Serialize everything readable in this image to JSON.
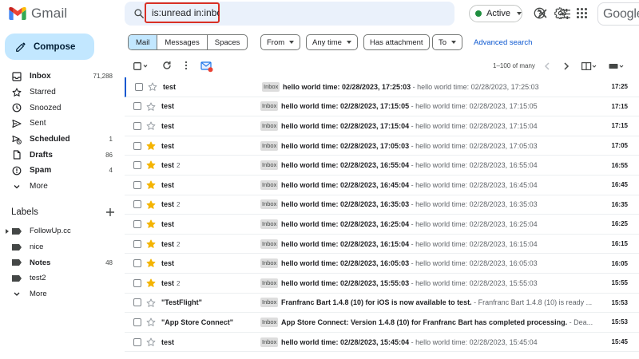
{
  "header": {
    "logo_text": "Gmail",
    "search_query": "is:unread in:inbox",
    "status_label": "Active",
    "status_color": "#1e8e3e",
    "account_brand_text": "Google"
  },
  "sidebar": {
    "compose_label": "Compose",
    "nav_items": [
      {
        "label": "Inbox",
        "count": "71,288",
        "icon": "inbox-icon",
        "bold": true
      },
      {
        "label": "Starred",
        "count": "",
        "icon": "star-icon",
        "bold": false
      },
      {
        "label": "Snoozed",
        "count": "",
        "icon": "clock-icon",
        "bold": false
      },
      {
        "label": "Sent",
        "count": "",
        "icon": "send-icon",
        "bold": false
      },
      {
        "label": "Scheduled",
        "count": "1",
        "icon": "scheduled-icon",
        "bold": true
      },
      {
        "label": "Drafts",
        "count": "86",
        "icon": "draft-icon",
        "bold": true
      },
      {
        "label": "Spam",
        "count": "4",
        "icon": "spam-icon",
        "bold": true
      },
      {
        "label": "More",
        "count": "",
        "icon": "chevron-down-icon",
        "bold": false
      }
    ],
    "labels_heading": "Labels",
    "labels": [
      {
        "label": "FollowUp.cc",
        "count": "",
        "expander": true,
        "bold": false
      },
      {
        "label": "nice",
        "count": "",
        "expander": false,
        "bold": false
      },
      {
        "label": "Notes",
        "count": "48",
        "expander": false,
        "bold": true
      },
      {
        "label": "test2",
        "count": "",
        "expander": false,
        "bold": false
      },
      {
        "label": "More",
        "count": "",
        "expander": false,
        "bold": false
      }
    ]
  },
  "filters": {
    "segments": [
      "Mail",
      "Messages",
      "Spaces"
    ],
    "active_segment": "Mail",
    "chips": [
      "From",
      "Any time",
      "Has attachment",
      "To"
    ],
    "advanced_search": "Advanced search"
  },
  "toolbar": {
    "range_text": "1–100 of many"
  },
  "emails": [
    {
      "sender": "test",
      "count": "",
      "starred": false,
      "badge": "Inbox",
      "subject": "hello world time: 02/28/2023, 17:25:03",
      "snippet": " - hello world time: 02/28/2023, 17:25:03",
      "time": "17:25"
    },
    {
      "sender": "test",
      "count": "",
      "starred": false,
      "badge": "Inbox",
      "subject": "hello world time: 02/28/2023, 17:15:05",
      "snippet": " - hello world time: 02/28/2023, 17:15:05",
      "time": "17:15"
    },
    {
      "sender": "test",
      "count": "",
      "starred": false,
      "badge": "Inbox",
      "subject": "hello world time: 02/28/2023, 17:15:04",
      "snippet": " - hello world time: 02/28/2023, 17:15:04",
      "time": "17:15"
    },
    {
      "sender": "test",
      "count": "",
      "starred": true,
      "badge": "Inbox",
      "subject": "hello world time: 02/28/2023, 17:05:03",
      "snippet": " - hello world time: 02/28/2023, 17:05:03",
      "time": "17:05"
    },
    {
      "sender": "test",
      "count": "2",
      "starred": true,
      "badge": "Inbox",
      "subject": "hello world time: 02/28/2023, 16:55:04",
      "snippet": " - hello world time: 02/28/2023, 16:55:04",
      "time": "16:55"
    },
    {
      "sender": "test",
      "count": "",
      "starred": true,
      "badge": "Inbox",
      "subject": "hello world time: 02/28/2023, 16:45:04",
      "snippet": " - hello world time: 02/28/2023, 16:45:04",
      "time": "16:45"
    },
    {
      "sender": "test",
      "count": "2",
      "starred": true,
      "badge": "Inbox",
      "subject": "hello world time: 02/28/2023, 16:35:03",
      "snippet": " - hello world time: 02/28/2023, 16:35:03",
      "time": "16:35"
    },
    {
      "sender": "test",
      "count": "",
      "starred": true,
      "badge": "Inbox",
      "subject": "hello world time: 02/28/2023, 16:25:04",
      "snippet": " - hello world time: 02/28/2023, 16:25:04",
      "time": "16:25"
    },
    {
      "sender": "test",
      "count": "2",
      "starred": true,
      "badge": "Inbox",
      "subject": "hello world time: 02/28/2023, 16:15:04",
      "snippet": " - hello world time: 02/28/2023, 16:15:04",
      "time": "16:15"
    },
    {
      "sender": "test",
      "count": "",
      "starred": true,
      "badge": "Inbox",
      "subject": "hello world time: 02/28/2023, 16:05:03",
      "snippet": " - hello world time: 02/28/2023, 16:05:03",
      "time": "16:05"
    },
    {
      "sender": "test",
      "count": "2",
      "starred": true,
      "badge": "Inbox",
      "subject": "hello world time: 02/28/2023, 15:55:03",
      "snippet": " - hello world time: 02/28/2023, 15:55:03",
      "time": "15:55"
    },
    {
      "sender": "\"TestFlight\"",
      "count": "",
      "starred": false,
      "badge": "Inbox",
      "subject": "Franfranc Bart 1.4.8 (10) for iOS is now available to test.",
      "snippet": " - Franfranc Bart 1.4.8 (10) is ready ...",
      "time": "15:53"
    },
    {
      "sender": "\"App Store Connect\"",
      "count": "",
      "starred": false,
      "badge": "Inbox",
      "subject": "App Store Connect: Version 1.4.8 (10) for Franfranc Bart has completed processing.",
      "snippet": " - Dea...",
      "time": "15:53"
    },
    {
      "sender": "test",
      "count": "",
      "starred": false,
      "badge": "Inbox",
      "subject": "hello world time: 02/28/2023, 15:45:04",
      "snippet": " - hello world time: 02/28/2023, 15:45:04",
      "time": "15:45"
    }
  ],
  "colors": {
    "accent": "#0b57d0",
    "compose_bg": "#c2e7ff",
    "search_bg": "#eaf1fb",
    "highlight_border": "#d93025",
    "star_yellow": "#f4b400"
  }
}
